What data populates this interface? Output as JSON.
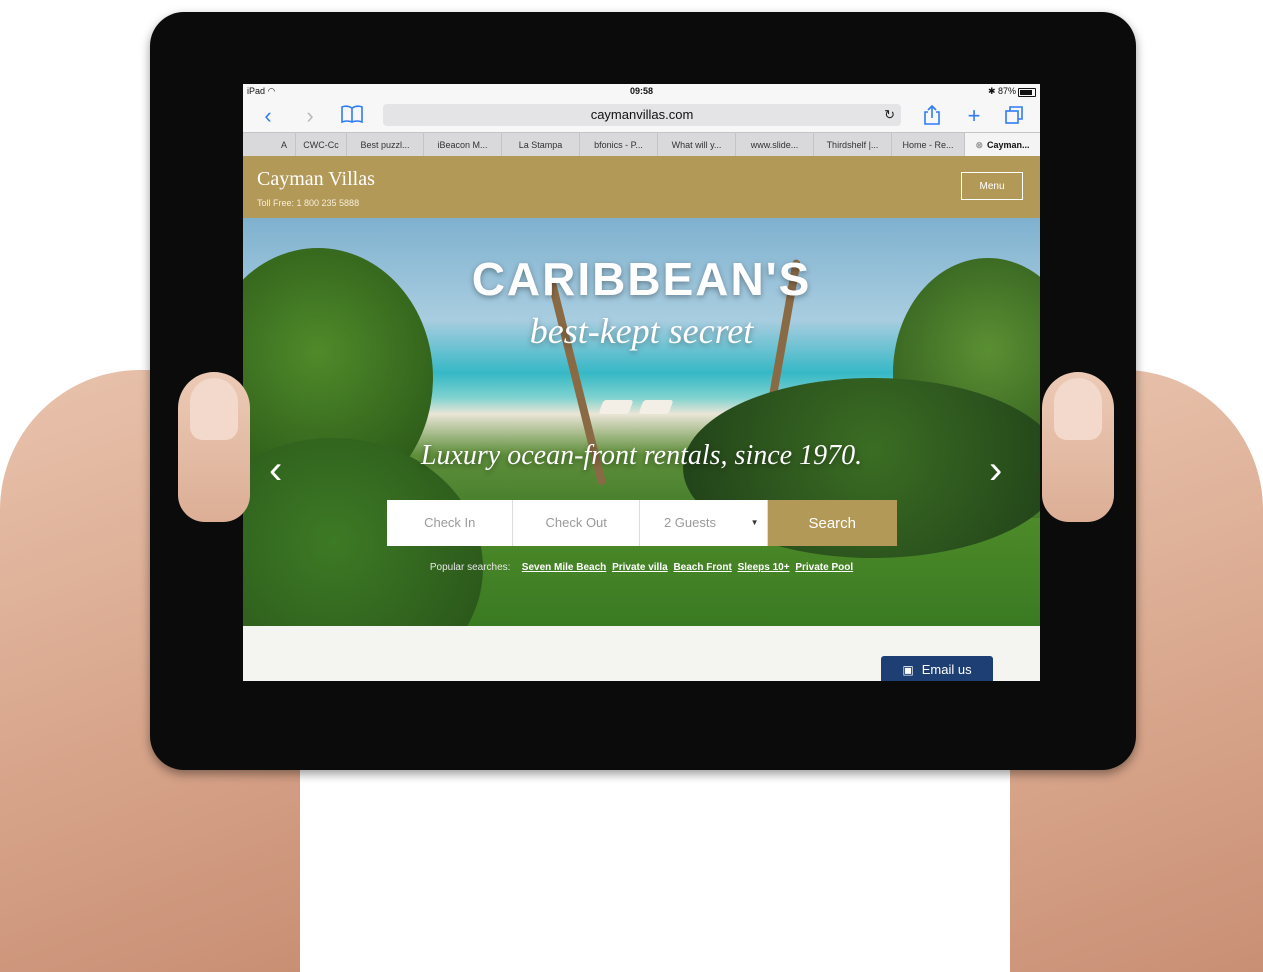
{
  "status_bar": {
    "device": "iPad",
    "wifi_icon": "wifi-icon",
    "time": "09:58",
    "battery": "87%"
  },
  "toolbar": {
    "back_icon": "chevron-left-icon",
    "forward_icon": "chevron-right-icon",
    "bookmarks_icon": "book-icon",
    "url": "caymanvillas.com",
    "reload_icon": "reload-icon",
    "share_icon": "share-icon",
    "add_icon": "plus-icon",
    "tabs_icon": "tabs-icon"
  },
  "tabs": [
    {
      "label": "A"
    },
    {
      "label": "CWC-Cc"
    },
    {
      "label": "Best puzzl..."
    },
    {
      "label": "iBeacon M..."
    },
    {
      "label": "La Stampa"
    },
    {
      "label": "bfonics - P..."
    },
    {
      "label": "What will y..."
    },
    {
      "label": "www.slide..."
    },
    {
      "label": "Thirdshelf |..."
    },
    {
      "label": "Home - Re..."
    },
    {
      "label": "Cayman..."
    }
  ],
  "site": {
    "brand": "Cayman Villas",
    "toll_free": "Toll Free: 1 800 235 5888",
    "menu_label": "Menu",
    "hero_title": "CARIBBEAN'S",
    "hero_subtitle": "best-kept secret",
    "hero_tagline": "Luxury ocean-front rentals, since 1970.",
    "check_in": "Check In",
    "check_out": "Check Out",
    "guests": "2 Guests",
    "search_label": "Search",
    "popular_label": "Popular searches:",
    "popular_links": [
      "Seven Mile Beach",
      "Private villa",
      "Beach Front",
      "Sleeps 10+",
      "Private Pool"
    ],
    "email_label": "Email us"
  },
  "colors": {
    "accent": "#b39958",
    "email": "#1e3f73",
    "link": "#2f7cf6"
  }
}
